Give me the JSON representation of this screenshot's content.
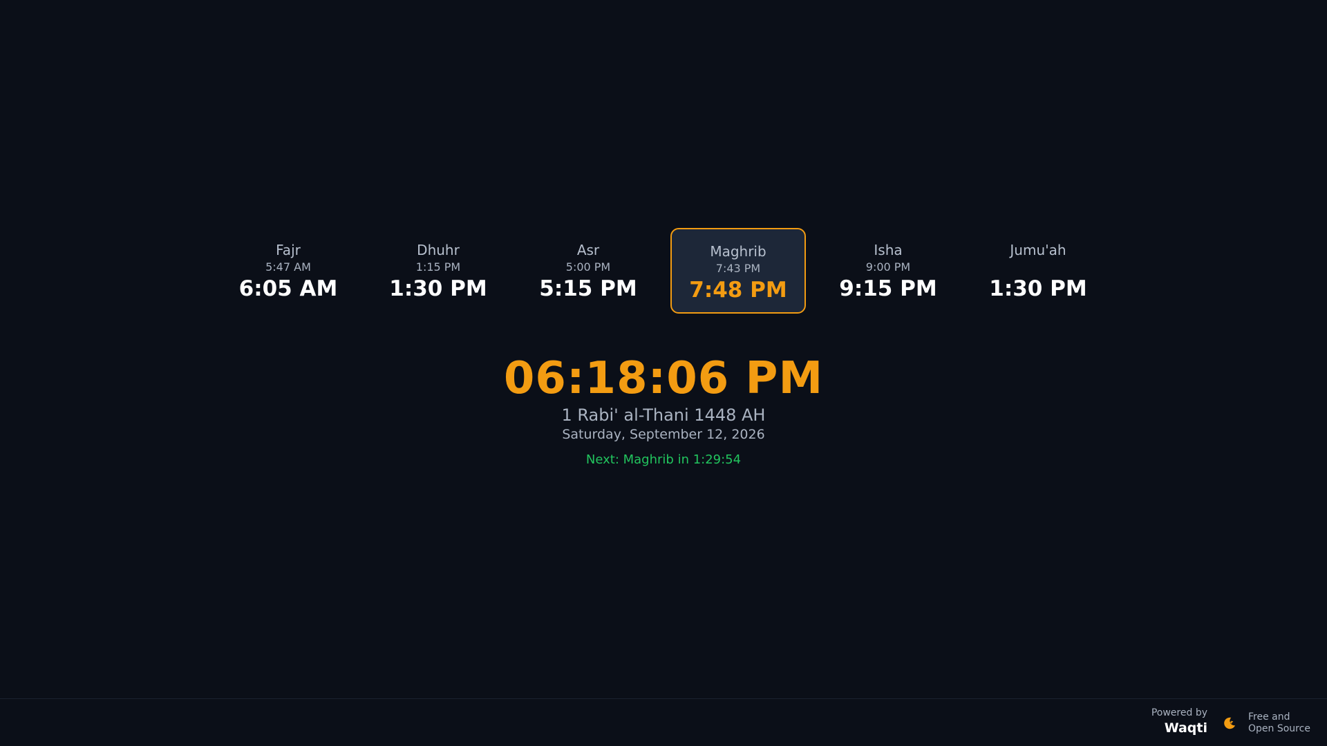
{
  "prayers": [
    {
      "name": "Fajr",
      "adhan": "5:47 AM",
      "iqama": "6:05 AM",
      "active": false
    },
    {
      "name": "Dhuhr",
      "adhan": "1:15 PM",
      "iqama": "1:30 PM",
      "active": false
    },
    {
      "name": "Asr",
      "adhan": "5:00 PM",
      "iqama": "5:15 PM",
      "active": false
    },
    {
      "name": "Maghrib",
      "adhan": "7:43 PM",
      "iqama": "7:48 PM",
      "active": true
    },
    {
      "name": "Isha",
      "adhan": "9:00 PM",
      "iqama": "9:15 PM",
      "active": false
    },
    {
      "name": "Jumu'ah",
      "adhan": "",
      "iqama": "1:30 PM",
      "active": false
    }
  ],
  "clock": {
    "time": "06:18:06 PM",
    "hijri_date": "1 Rabi' al-Thani 1448 AH",
    "gregorian_date": "Saturday, September 12, 2026",
    "next_prayer": "Next: Maghrib in 1:29:54"
  },
  "footer": {
    "powered_by_label": "Powered by",
    "brand": "Waqti",
    "free_line1": "Free and",
    "free_line2": "Open Source",
    "logo_icon": "crescent-moon-icon"
  },
  "colors": {
    "background": "#0b0f18",
    "accent": "#f39c12",
    "active_card_bg": "#1d2738",
    "next_prayer_text": "#22c55e",
    "muted_text": "#aab3c1"
  }
}
